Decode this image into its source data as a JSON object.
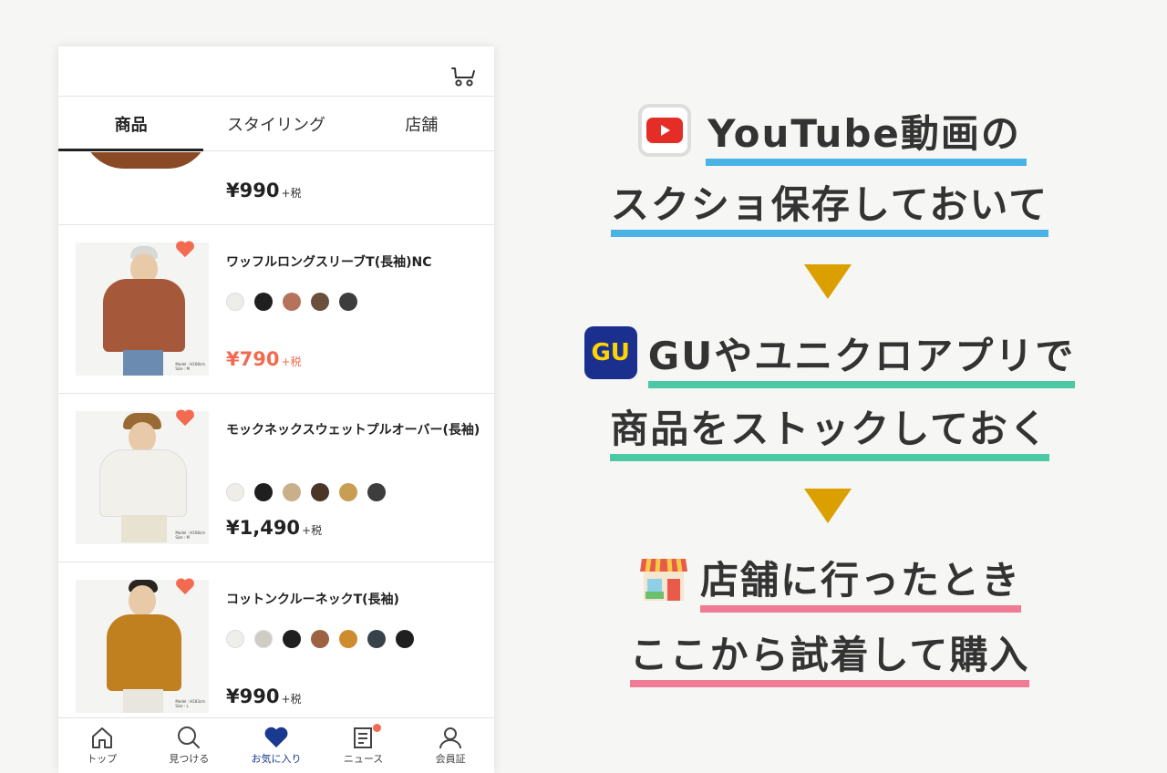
{
  "tabs": [
    "商品",
    "スタイリング",
    "店舗"
  ],
  "partial_item": {
    "price": "¥990",
    "tax": "+税"
  },
  "items": [
    {
      "name": "ワッフルロングスリーブT(長袖)NC",
      "price": "¥790",
      "tax": "+税",
      "sale": true,
      "caption": [
        "Model : H168cm",
        "Size : M"
      ],
      "colors": [
        "#ededea",
        "#1f1f1f",
        "#b6735c",
        "#6b4f3e",
        "#3d3d3d"
      ]
    },
    {
      "name": "モックネックスウェットプルオーバー(長袖)",
      "price": "¥1,490",
      "tax": "+税",
      "sale": false,
      "caption": [
        "Model : H168cm",
        "Size : M"
      ],
      "colors": [
        "#eeede8",
        "#1f1f1f",
        "#c9b08a",
        "#4a3527",
        "#c89f52",
        "#3d3d3d"
      ]
    },
    {
      "name": "コットンクルーネックT(長袖)",
      "price": "¥990",
      "tax": "+税",
      "sale": false,
      "caption": [
        "Model : H183cm",
        "Size : L"
      ],
      "colors": [
        "#eeeeea",
        "#cfccc4",
        "#1f1f1f",
        "#9c6242",
        "#cf8c2e",
        "#38424a",
        "#1f1f1f"
      ]
    }
  ],
  "nav": [
    {
      "label": "トップ",
      "icon": "home-icon"
    },
    {
      "label": "見つける",
      "icon": "search-icon"
    },
    {
      "label": "お気に入り",
      "icon": "heart-icon",
      "active": true
    },
    {
      "label": "ニュース",
      "icon": "news-icon",
      "badge": true
    },
    {
      "label": "会員証",
      "icon": "user-icon"
    }
  ],
  "colors": {
    "accent_blue": "#4ab3e6",
    "accent_green": "#4cc8a5",
    "accent_pink": "#ef7b95",
    "arrow": "#dba000",
    "heart": "#f26b50"
  },
  "steps": {
    "s1_line1": "YouTube動画の",
    "s1_line2": "スクショ保存しておいて",
    "s2_line1": "GUやユニクロアプリで",
    "s2_line2": "商品をストックしておく",
    "s3_line1": "店舗に行ったとき",
    "s3_line2": "ここから試着して購入",
    "gu_logo": "GU"
  }
}
